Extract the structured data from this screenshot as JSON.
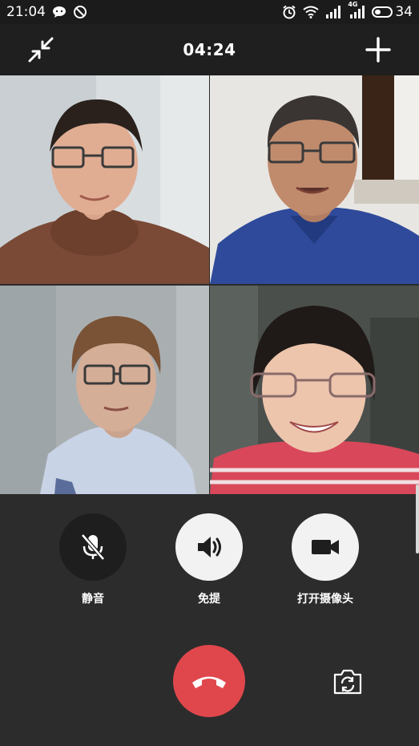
{
  "status_bar": {
    "time": "21:04",
    "battery": "34",
    "left_icons": [
      "chat-bubble-icon",
      "no-disturb-icon"
    ],
    "right_icons": [
      "alarm-icon",
      "wifi-icon",
      "signal-icon",
      "4g-signal-icon",
      "battery-icon"
    ],
    "network_label": "4G"
  },
  "call_header": {
    "duration": "04:24",
    "left_icon": "minimize-arrows-icon",
    "right_icon": "add-icon"
  },
  "participants": [
    {
      "id": "participant-1"
    },
    {
      "id": "participant-2"
    },
    {
      "id": "participant-3"
    },
    {
      "id": "participant-4"
    }
  ],
  "controls": {
    "mute_label": "静音",
    "speaker_label": "免提",
    "camera_label": "打开摄像头",
    "hangup_icon": "phone-hangup-icon",
    "flip_icon": "camera-flip-icon"
  },
  "colors": {
    "hangup": "#e0474c",
    "control_light": "#f2f2f2",
    "control_dark": "#1e1e1e",
    "background": "#2c2c2c"
  }
}
